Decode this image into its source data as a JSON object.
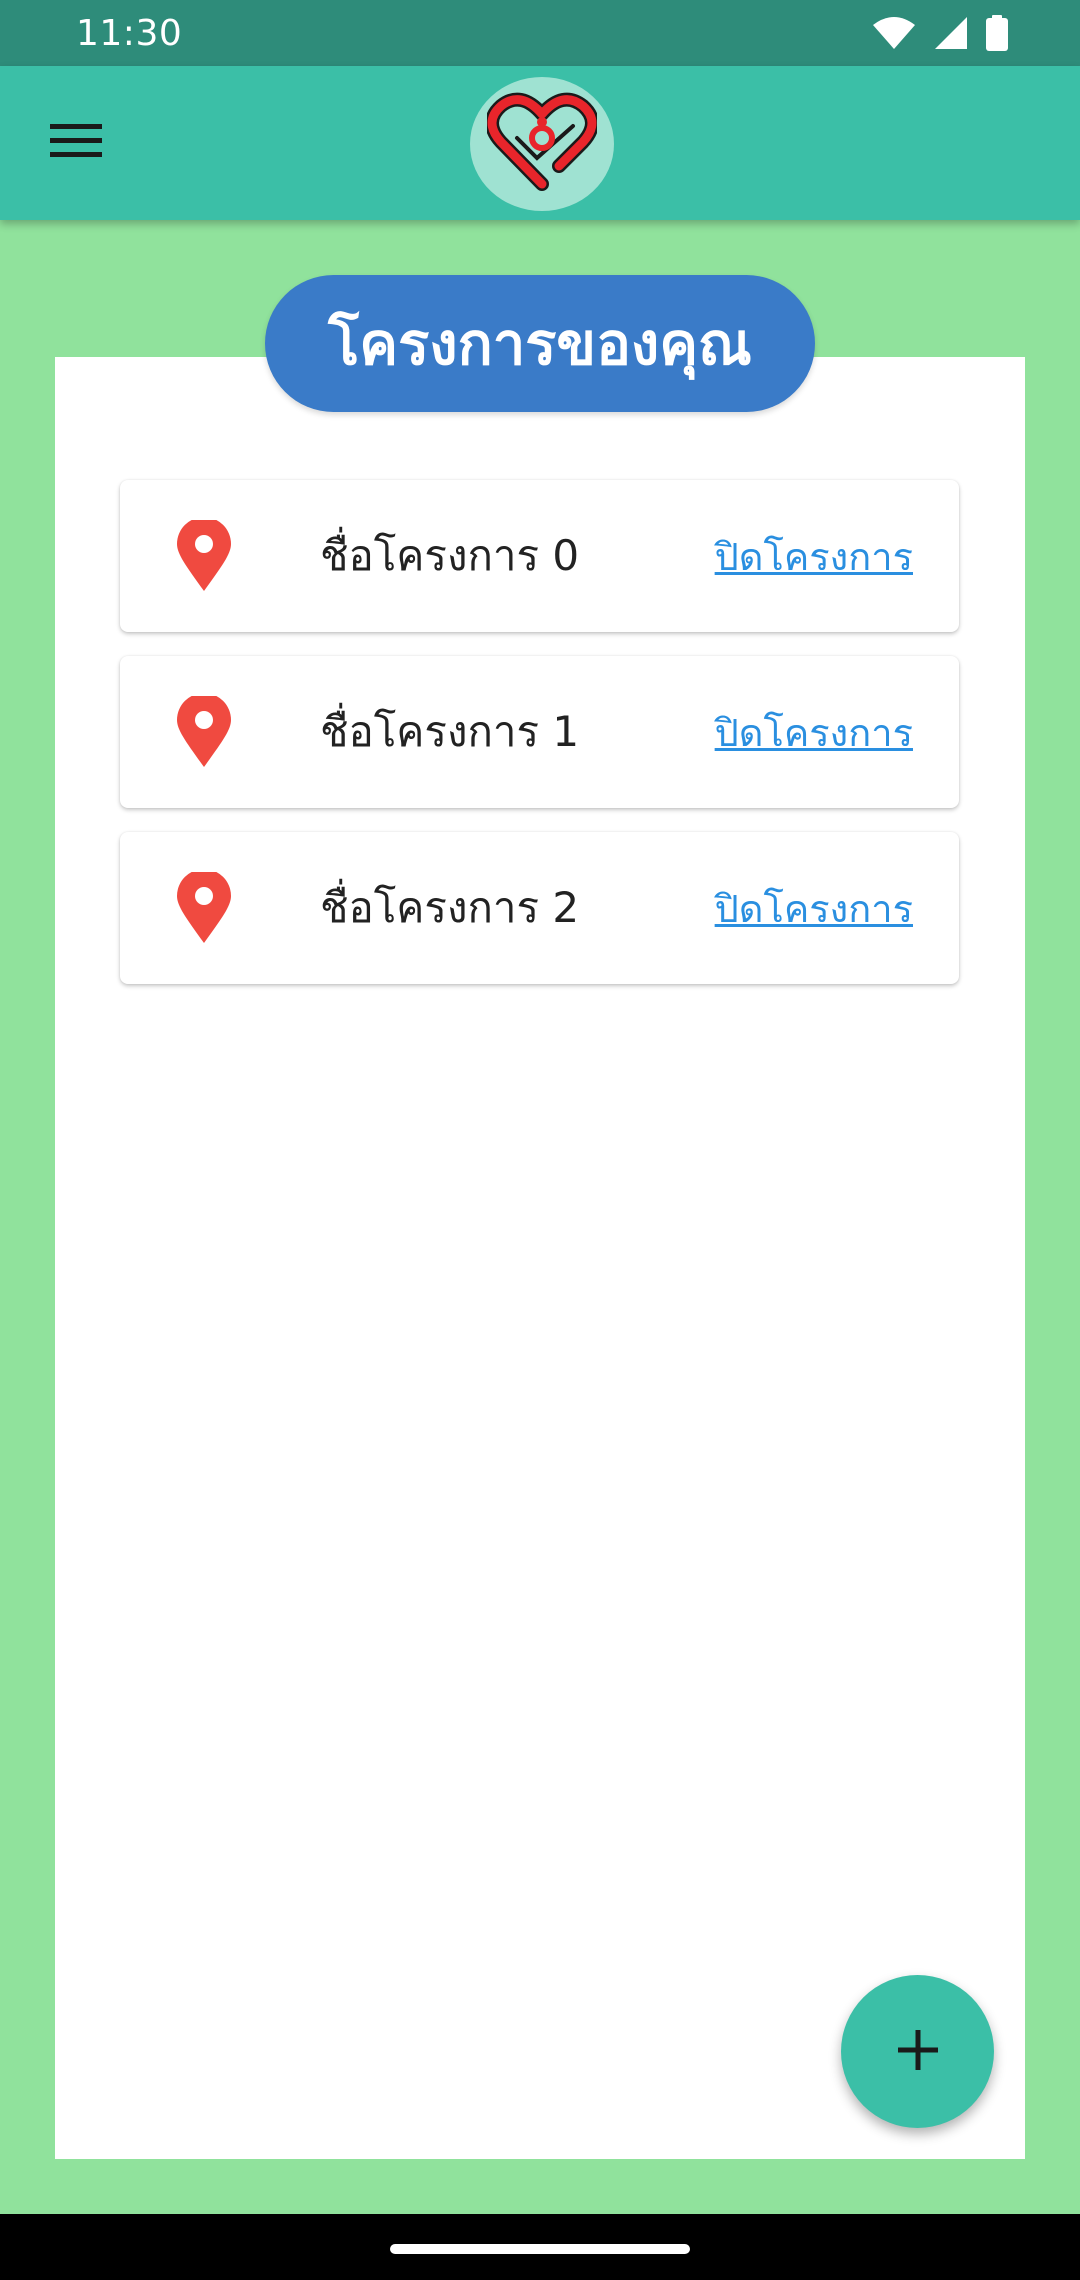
{
  "status_bar": {
    "time": "11:30",
    "icons": [
      "wifi-icon",
      "signal-icon",
      "battery-icon"
    ]
  },
  "app_bar": {
    "menu_icon": "hamburger-menu-icon",
    "logo": "heart-check-logo"
  },
  "main": {
    "title": "โครงการของคุณ",
    "projects": [
      {
        "name": "ชื่อโครงการ 0",
        "action_label": "ปิดโครงการ",
        "icon": "location-pin-icon"
      },
      {
        "name": "ชื่อโครงการ 1",
        "action_label": "ปิดโครงการ",
        "icon": "location-pin-icon"
      },
      {
        "name": "ชื่อโครงการ 2",
        "action_label": "ปิดโครงการ",
        "icon": "location-pin-icon"
      }
    ]
  },
  "fab": {
    "icon": "plus-icon"
  },
  "colors": {
    "status_bar": "#2E8C7A",
    "app_bar": "#3BBFA7",
    "background": "#90E29C",
    "title_pill": "#3A7BC8",
    "pin": "#F04A40",
    "link": "#2A8FE0",
    "fab": "#3BBFA7"
  }
}
